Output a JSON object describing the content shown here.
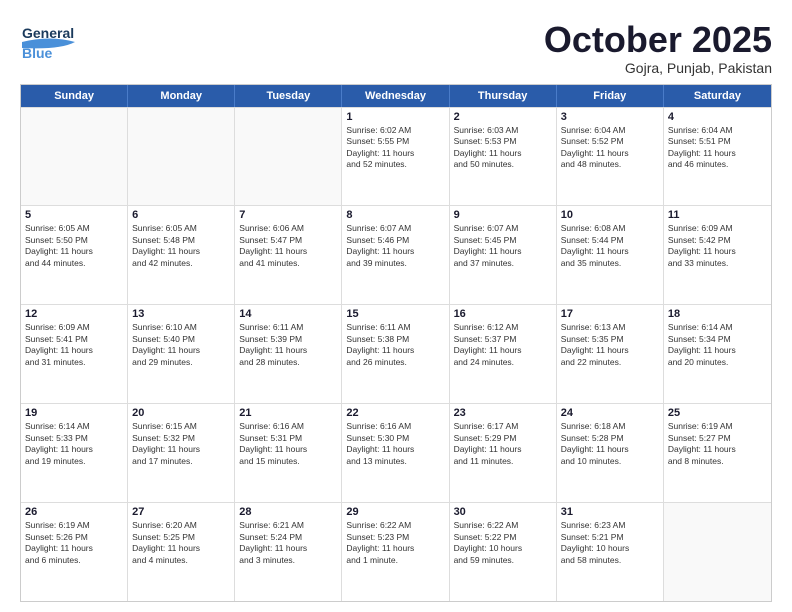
{
  "logo": {
    "line1": "General",
    "line2": "Blue"
  },
  "title": "October 2025",
  "location": "Gojra, Punjab, Pakistan",
  "days": [
    "Sunday",
    "Monday",
    "Tuesday",
    "Wednesday",
    "Thursday",
    "Friday",
    "Saturday"
  ],
  "rows": [
    [
      {
        "day": "",
        "info": ""
      },
      {
        "day": "",
        "info": ""
      },
      {
        "day": "",
        "info": ""
      },
      {
        "day": "1",
        "info": "Sunrise: 6:02 AM\nSunset: 5:55 PM\nDaylight: 11 hours\nand 52 minutes."
      },
      {
        "day": "2",
        "info": "Sunrise: 6:03 AM\nSunset: 5:53 PM\nDaylight: 11 hours\nand 50 minutes."
      },
      {
        "day": "3",
        "info": "Sunrise: 6:04 AM\nSunset: 5:52 PM\nDaylight: 11 hours\nand 48 minutes."
      },
      {
        "day": "4",
        "info": "Sunrise: 6:04 AM\nSunset: 5:51 PM\nDaylight: 11 hours\nand 46 minutes."
      }
    ],
    [
      {
        "day": "5",
        "info": "Sunrise: 6:05 AM\nSunset: 5:50 PM\nDaylight: 11 hours\nand 44 minutes."
      },
      {
        "day": "6",
        "info": "Sunrise: 6:05 AM\nSunset: 5:48 PM\nDaylight: 11 hours\nand 42 minutes."
      },
      {
        "day": "7",
        "info": "Sunrise: 6:06 AM\nSunset: 5:47 PM\nDaylight: 11 hours\nand 41 minutes."
      },
      {
        "day": "8",
        "info": "Sunrise: 6:07 AM\nSunset: 5:46 PM\nDaylight: 11 hours\nand 39 minutes."
      },
      {
        "day": "9",
        "info": "Sunrise: 6:07 AM\nSunset: 5:45 PM\nDaylight: 11 hours\nand 37 minutes."
      },
      {
        "day": "10",
        "info": "Sunrise: 6:08 AM\nSunset: 5:44 PM\nDaylight: 11 hours\nand 35 minutes."
      },
      {
        "day": "11",
        "info": "Sunrise: 6:09 AM\nSunset: 5:42 PM\nDaylight: 11 hours\nand 33 minutes."
      }
    ],
    [
      {
        "day": "12",
        "info": "Sunrise: 6:09 AM\nSunset: 5:41 PM\nDaylight: 11 hours\nand 31 minutes."
      },
      {
        "day": "13",
        "info": "Sunrise: 6:10 AM\nSunset: 5:40 PM\nDaylight: 11 hours\nand 29 minutes."
      },
      {
        "day": "14",
        "info": "Sunrise: 6:11 AM\nSunset: 5:39 PM\nDaylight: 11 hours\nand 28 minutes."
      },
      {
        "day": "15",
        "info": "Sunrise: 6:11 AM\nSunset: 5:38 PM\nDaylight: 11 hours\nand 26 minutes."
      },
      {
        "day": "16",
        "info": "Sunrise: 6:12 AM\nSunset: 5:37 PM\nDaylight: 11 hours\nand 24 minutes."
      },
      {
        "day": "17",
        "info": "Sunrise: 6:13 AM\nSunset: 5:35 PM\nDaylight: 11 hours\nand 22 minutes."
      },
      {
        "day": "18",
        "info": "Sunrise: 6:14 AM\nSunset: 5:34 PM\nDaylight: 11 hours\nand 20 minutes."
      }
    ],
    [
      {
        "day": "19",
        "info": "Sunrise: 6:14 AM\nSunset: 5:33 PM\nDaylight: 11 hours\nand 19 minutes."
      },
      {
        "day": "20",
        "info": "Sunrise: 6:15 AM\nSunset: 5:32 PM\nDaylight: 11 hours\nand 17 minutes."
      },
      {
        "day": "21",
        "info": "Sunrise: 6:16 AM\nSunset: 5:31 PM\nDaylight: 11 hours\nand 15 minutes."
      },
      {
        "day": "22",
        "info": "Sunrise: 6:16 AM\nSunset: 5:30 PM\nDaylight: 11 hours\nand 13 minutes."
      },
      {
        "day": "23",
        "info": "Sunrise: 6:17 AM\nSunset: 5:29 PM\nDaylight: 11 hours\nand 11 minutes."
      },
      {
        "day": "24",
        "info": "Sunrise: 6:18 AM\nSunset: 5:28 PM\nDaylight: 11 hours\nand 10 minutes."
      },
      {
        "day": "25",
        "info": "Sunrise: 6:19 AM\nSunset: 5:27 PM\nDaylight: 11 hours\nand 8 minutes."
      }
    ],
    [
      {
        "day": "26",
        "info": "Sunrise: 6:19 AM\nSunset: 5:26 PM\nDaylight: 11 hours\nand 6 minutes."
      },
      {
        "day": "27",
        "info": "Sunrise: 6:20 AM\nSunset: 5:25 PM\nDaylight: 11 hours\nand 4 minutes."
      },
      {
        "day": "28",
        "info": "Sunrise: 6:21 AM\nSunset: 5:24 PM\nDaylight: 11 hours\nand 3 minutes."
      },
      {
        "day": "29",
        "info": "Sunrise: 6:22 AM\nSunset: 5:23 PM\nDaylight: 11 hours\nand 1 minute."
      },
      {
        "day": "30",
        "info": "Sunrise: 6:22 AM\nSunset: 5:22 PM\nDaylight: 10 hours\nand 59 minutes."
      },
      {
        "day": "31",
        "info": "Sunrise: 6:23 AM\nSunset: 5:21 PM\nDaylight: 10 hours\nand 58 minutes."
      },
      {
        "day": "",
        "info": ""
      }
    ]
  ]
}
